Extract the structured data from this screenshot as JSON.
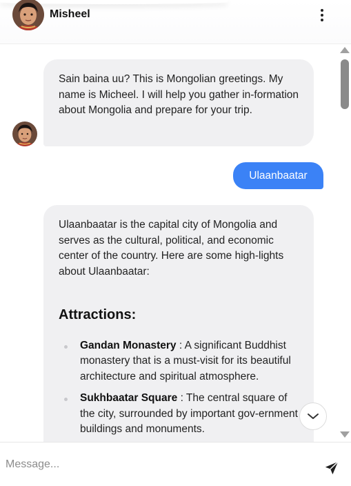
{
  "header": {
    "name": "Misheel",
    "menu_icon": "more-vertical-icon"
  },
  "messages": {
    "greeting": "Sain baina uu? This is Mongolian greetings. My name is Micheel. I will help you gather in-formation about Mongolia and prepare for your trip.",
    "user_query": "Ulaanbaatar",
    "answer_intro": "Ulaanbaatar is the capital city of Mongolia and serves as the cultural, political, and economic center of the country. Here are some high-lights about Ulaanbaatar:",
    "answer_heading": "Attractions:",
    "attractions": [
      {
        "name": "Gandan Monastery",
        "description": " : A significant Buddhist monastery that is a must-visit for its beautiful architecture and spiritual atmosphere."
      },
      {
        "name": "Sukhbaatar Square",
        "description": " : The central square of the city, surrounded by important gov-ernment buildings and monuments."
      }
    ]
  },
  "composer": {
    "placeholder": "Message...",
    "send_icon": "send-icon"
  },
  "colors": {
    "user_bubble": "#3b82f6",
    "bot_bubble": "#f0f0f2"
  }
}
